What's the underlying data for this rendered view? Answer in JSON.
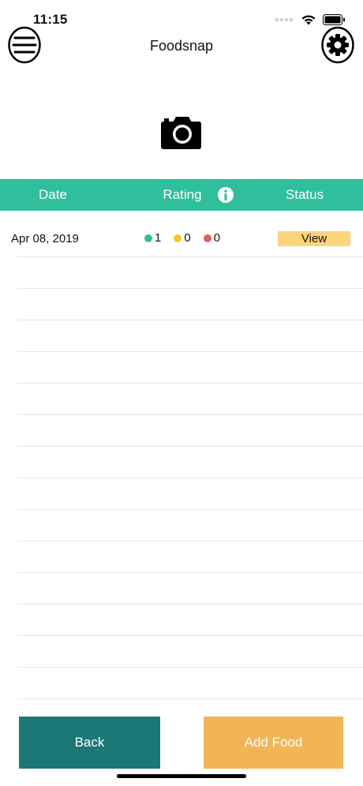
{
  "status_bar": {
    "time": "11:15"
  },
  "nav": {
    "title": "Foodsnap",
    "menu_icon": "hamburger-menu-icon",
    "settings_icon": "gear-icon"
  },
  "camera": {
    "icon": "camera-icon"
  },
  "table": {
    "headers": {
      "date": "Date",
      "rating": "Rating",
      "status": "Status"
    },
    "rows": [
      {
        "date": "Apr 08, 2019",
        "green_count": "1",
        "yellow_count": "0",
        "red_count": "0",
        "status_label": "View"
      }
    ]
  },
  "colors": {
    "accent": "#2fbf9c",
    "green_dot": "#2fbf9c",
    "yellow_dot": "#f5cc1b",
    "red_dot": "#e85a5e",
    "view_badge": "#fcd47a",
    "back_button": "#1b7876",
    "add_food_button": "#f2b455"
  },
  "footer": {
    "back_label": "Back",
    "add_food_label": "Add Food"
  }
}
